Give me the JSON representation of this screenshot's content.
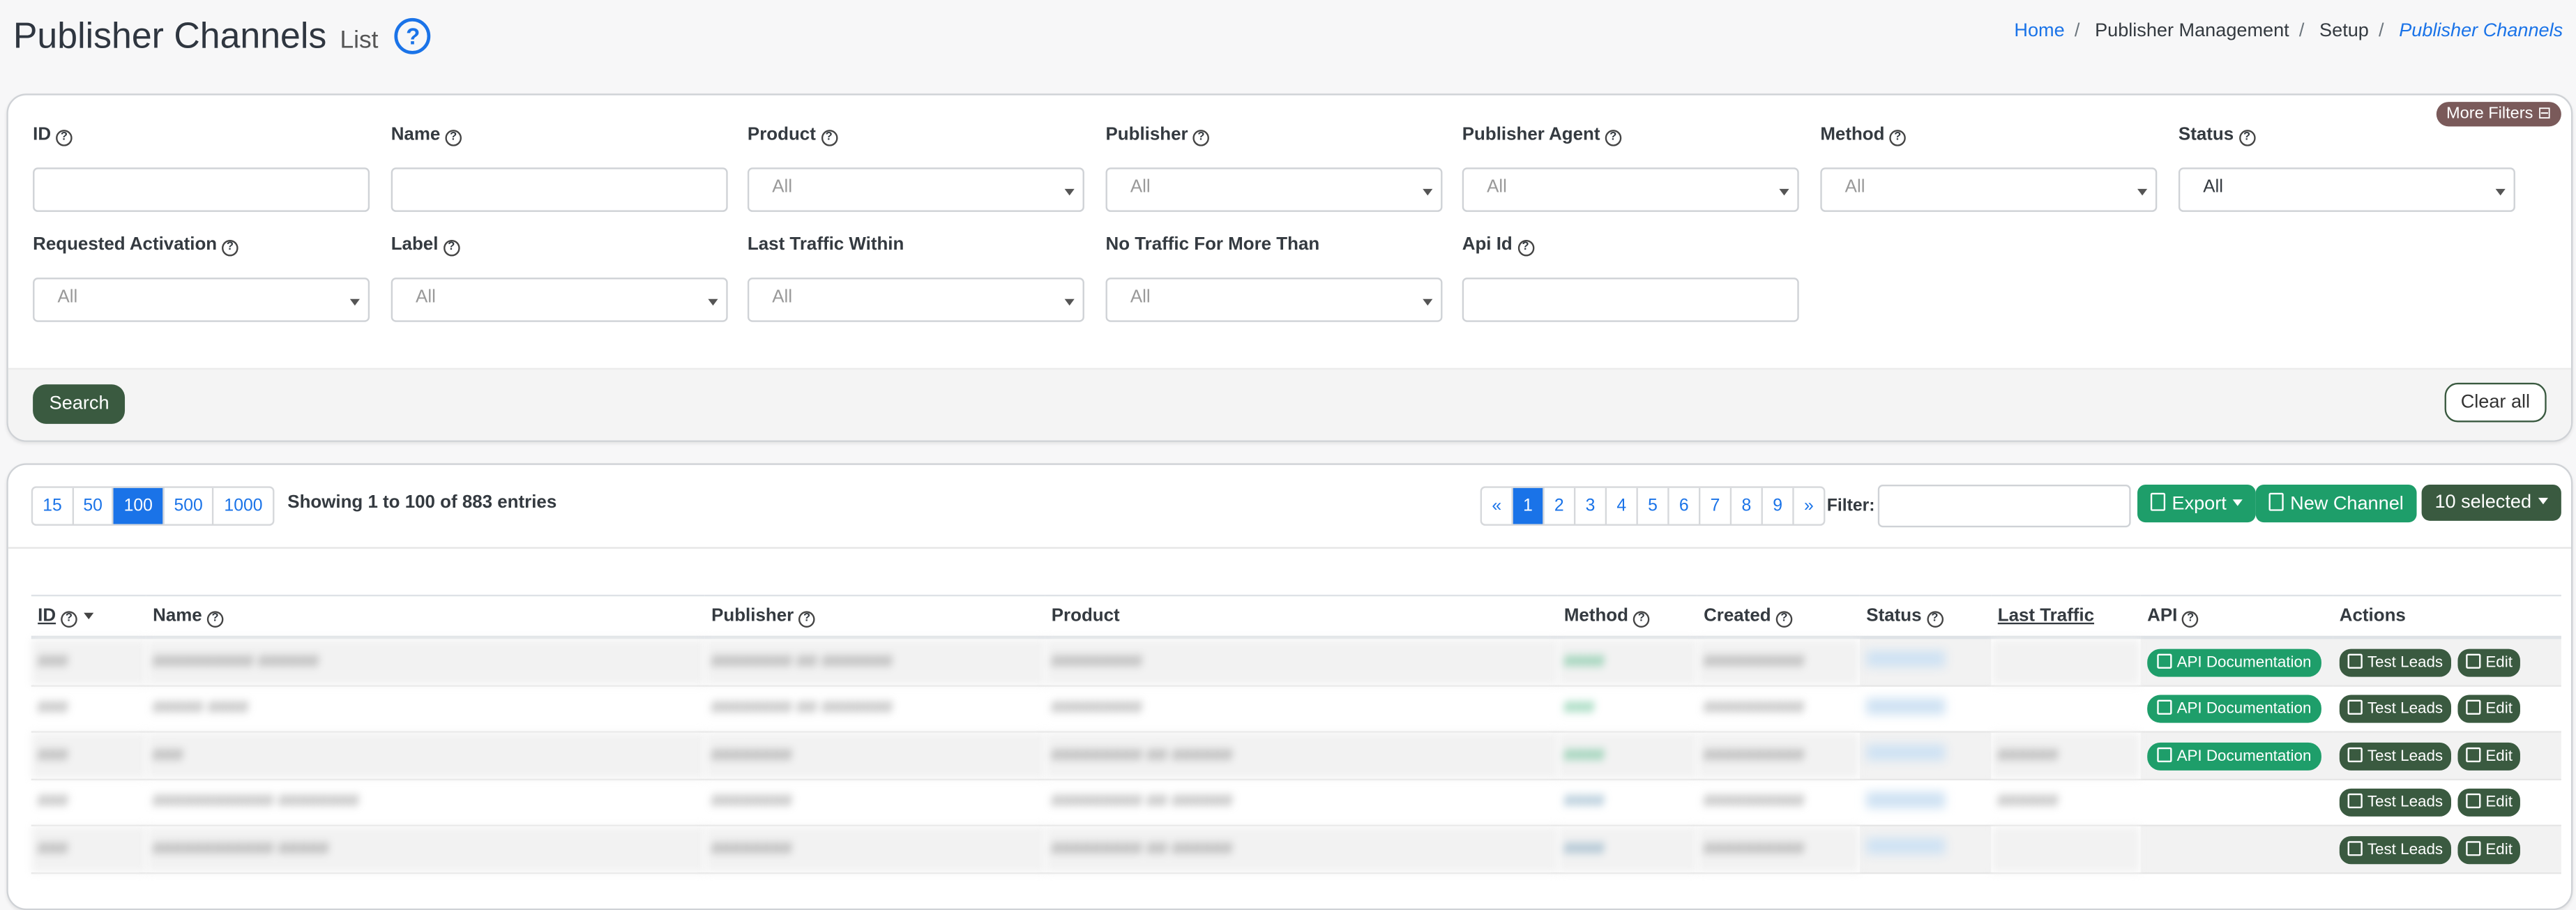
{
  "header": {
    "title": "Publisher Channels",
    "subtitle": "List",
    "help_icon": "question-circle-icon"
  },
  "breadcrumb": {
    "home": "Home",
    "item1": "Publisher Management",
    "item2": "Setup",
    "current": "Publisher Channels"
  },
  "filters": {
    "more_filters": "More Filters",
    "fields": [
      {
        "label": "ID",
        "value": ""
      },
      {
        "label": "Name",
        "value": ""
      },
      {
        "label": "Product",
        "value": "All"
      },
      {
        "label": "Publisher",
        "value": "All"
      },
      {
        "label": "Publisher Agent",
        "value": "All"
      },
      {
        "label": "Method",
        "value": "All"
      },
      {
        "label": "Status",
        "value": "All"
      },
      {
        "label": "Requested Activation",
        "value": "All"
      },
      {
        "label": "Label",
        "value": "All"
      },
      {
        "label": "Last Traffic Within",
        "value": "All"
      },
      {
        "label": "No Traffic For More Than",
        "value": "All"
      },
      {
        "label": "Api Id",
        "value": ""
      }
    ],
    "search_label": "Search",
    "clear_label": "Clear all"
  },
  "list": {
    "per_page": [
      "15",
      "50",
      "100",
      "500",
      "1000"
    ],
    "per_page_selected": "100",
    "showing": "Showing 1 to 100 of 883 entries",
    "pages": [
      "«",
      "1",
      "2",
      "3",
      "4",
      "5",
      "6",
      "7",
      "8",
      "9",
      "»"
    ],
    "current_page": "1",
    "filter_label": "Filter:",
    "filter_value": "",
    "export_label": "Export",
    "new_label": "New Channel",
    "selected_label": "10 selected"
  },
  "table": {
    "columns": [
      "ID",
      "Name",
      "Publisher",
      "Product",
      "Method",
      "Created",
      "Status",
      "Last Traffic",
      "API",
      "Actions"
    ],
    "rows": [
      {
        "id": "###",
        "name": "########## ######",
        "publisher": "######## ## #######",
        "product": "#########",
        "method": "####",
        "created": "##########",
        "last_traffic": "",
        "api": "API Documentation"
      },
      {
        "id": "###",
        "name": "##### ####",
        "publisher": "######## ## #######",
        "product": "#########",
        "method": "###",
        "created": "##########",
        "last_traffic": "",
        "api": "API Documentation"
      },
      {
        "id": "###",
        "name": "###",
        "publisher": "########",
        "product": "######### ## ######",
        "method": "####",
        "created": "##########",
        "last_traffic": "######",
        "api": "API Documentation"
      },
      {
        "id": "###",
        "name": "############ ########",
        "publisher": "########",
        "product": "######### ## ######",
        "method": "####",
        "created": "##########",
        "last_traffic": "######",
        "api": ""
      },
      {
        "id": "###",
        "name": "############ #####",
        "publisher": "########",
        "product": "######### ## ######",
        "method": "####",
        "created": "##########",
        "last_traffic": "",
        "api": ""
      }
    ],
    "action_test": "Test Leads",
    "action_edit": "Edit"
  }
}
